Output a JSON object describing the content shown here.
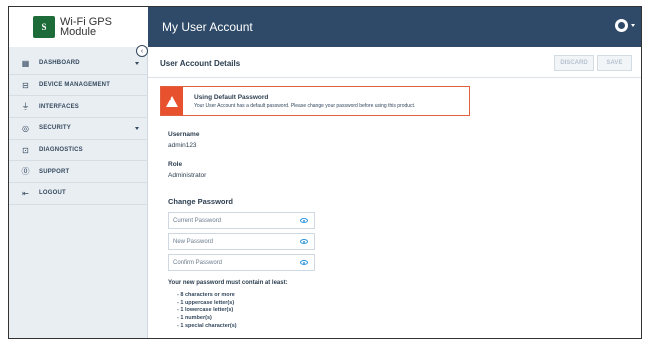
{
  "logo": {
    "mark": "S",
    "line1": "Wi-Fi GPS",
    "line2": "Module"
  },
  "sidebar": {
    "items": [
      {
        "label": "DASHBOARD",
        "icon": "grid-icon",
        "has_caret": true
      },
      {
        "label": "DEVICE MANAGEMENT",
        "icon": "box-icon",
        "has_caret": false
      },
      {
        "label": "INTERFACES",
        "icon": "plug-icon",
        "has_caret": false
      },
      {
        "label": "SECURITY",
        "icon": "shield-icon",
        "has_caret": true
      },
      {
        "label": "DIAGNOSTICS",
        "icon": "chart-icon",
        "has_caret": false
      },
      {
        "label": "SUPPORT",
        "icon": "help-icon",
        "has_caret": false
      },
      {
        "label": "LOGOUT",
        "icon": "logout-icon",
        "has_caret": false
      }
    ]
  },
  "header": {
    "title": "My User Account"
  },
  "main": {
    "page_title": "User Account Details",
    "discard_label": "DISCARD",
    "save_label": "SAVE",
    "alert": {
      "title": "Using Default Password",
      "text": "Your User Account has a default password. Please change your password before using this product."
    },
    "username_label": "Username",
    "username_value": "admin123",
    "role_label": "Role",
    "role_value": "Administrator",
    "change_password_title": "Change Password",
    "current_password_placeholder": "Current Password",
    "new_password_placeholder": "New Password",
    "confirm_password_placeholder": "Confirm Password",
    "requirements_intro": "Your new password must contain at least:",
    "requirements": [
      "- 8 characters or more",
      "- 1 uppercase letter(s)",
      "- 1 lowercase letter(s)",
      "- 1 number(s)",
      "- 1 special character(s)"
    ]
  },
  "colors": {
    "header_bg": "#2e4a68",
    "sidebar_bg": "#e9eef3",
    "alert_accent": "#e8512d",
    "eye_icon": "#3498db"
  }
}
